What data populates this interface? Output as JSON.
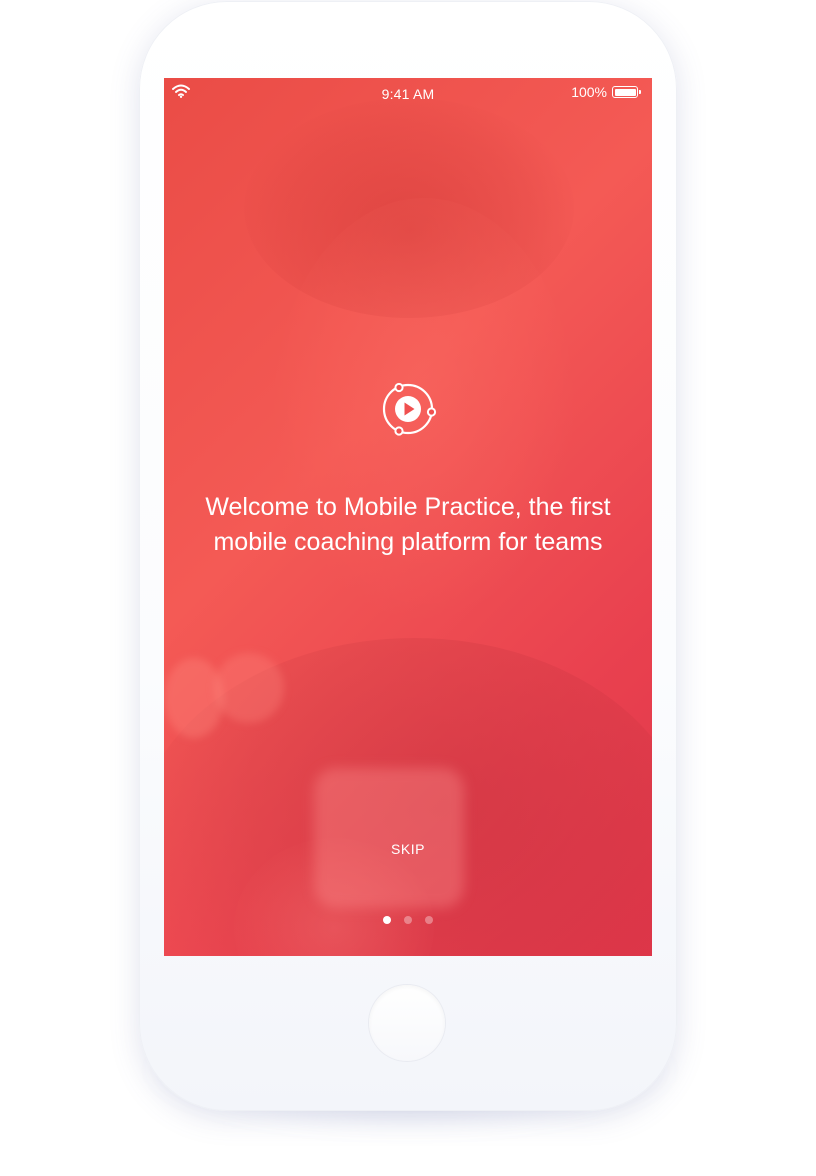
{
  "status_bar": {
    "time": "9:41 AM",
    "battery_percent": "100%",
    "battery_level": 1.0,
    "wifi_icon": "wifi-icon",
    "battery_icon": "battery-icon"
  },
  "onboarding": {
    "logo_icon": "play-orbit-icon",
    "headline": "Welcome to Mobile Practice, the first mobile coaching platform for teams",
    "skip_label": "SKIP",
    "pagination": {
      "total_pages": 3,
      "current_page": 1
    }
  },
  "colors": {
    "accent": "#f0504f",
    "accent_dark": "#e0364a",
    "text": "#ffffff"
  }
}
